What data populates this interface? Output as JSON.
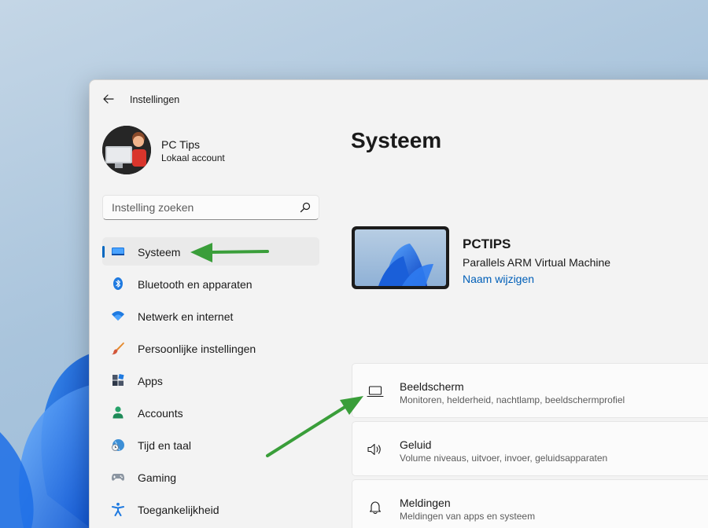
{
  "window": {
    "title": "Instellingen"
  },
  "profile": {
    "name": "PC Tips",
    "account_type": "Lokaal account"
  },
  "search": {
    "placeholder": "Instelling zoeken"
  },
  "sidebar": {
    "items": [
      {
        "label": "Systeem",
        "icon": "monitor-icon",
        "selected": true
      },
      {
        "label": "Bluetooth en apparaten",
        "icon": "bluetooth-icon"
      },
      {
        "label": "Netwerk en internet",
        "icon": "wifi-icon"
      },
      {
        "label": "Persoonlijke instellingen",
        "icon": "brush-icon"
      },
      {
        "label": "Apps",
        "icon": "apps-icon"
      },
      {
        "label": "Accounts",
        "icon": "person-icon"
      },
      {
        "label": "Tijd en taal",
        "icon": "clock-globe-icon"
      },
      {
        "label": "Gaming",
        "icon": "gamepad-icon"
      },
      {
        "label": "Toegankelijkheid",
        "icon": "accessibility-icon"
      }
    ]
  },
  "main": {
    "title": "Systeem",
    "device": {
      "name": "PCTIPS",
      "model": "Parallels ARM Virtual Machine",
      "rename_label": "Naam wijzigen"
    },
    "cards": [
      {
        "title": "Beeldscherm",
        "subtitle": "Monitoren, helderheid, nachtlamp, beeldschermprofiel",
        "icon": "laptop-icon"
      },
      {
        "title": "Geluid",
        "subtitle": "Volume niveaus, uitvoer, invoer, geluidsapparaten",
        "icon": "speaker-icon"
      },
      {
        "title": "Meldingen",
        "subtitle": "Meldingen van apps en systeem",
        "icon": "bell-icon"
      }
    ]
  },
  "colors": {
    "accent": "#0067c0",
    "link": "#005fb8",
    "annotation_arrow": "#3a9e3a"
  }
}
